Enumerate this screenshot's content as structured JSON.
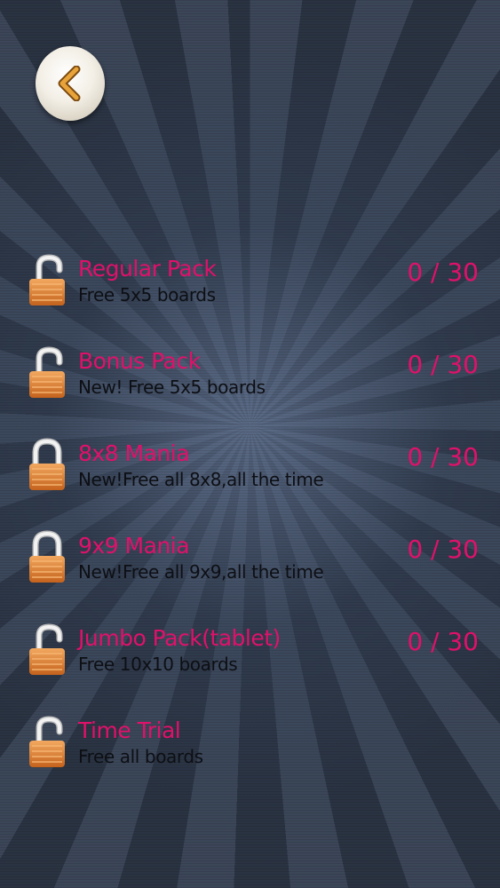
{
  "colors": {
    "accent": "#e0116a",
    "subtitle": "#0d0f14",
    "lock_body": "#e38a3c",
    "lock_shackle": "#e8e8e8"
  },
  "back_button": {
    "icon": "chevron-left-icon"
  },
  "packs": [
    {
      "title": "Regular Pack",
      "subtitle": "Free 5x5 boards",
      "progress": "0 / 30",
      "lock": "unlocked"
    },
    {
      "title": "Bonus Pack",
      "subtitle": "New! Free 5x5 boards",
      "progress": "0 / 30",
      "lock": "unlocked"
    },
    {
      "title": "8x8 Mania",
      "subtitle": "New!Free all 8x8,all the time",
      "progress": "0 / 30",
      "lock": "locked"
    },
    {
      "title": "9x9 Mania",
      "subtitle": "New!Free all 9x9,all the time",
      "progress": "0 / 30",
      "lock": "locked"
    },
    {
      "title": "Jumbo Pack(tablet)",
      "subtitle": "Free 10x10 boards",
      "progress": "0 / 30",
      "lock": "unlocked"
    },
    {
      "title": "Time Trial",
      "subtitle": "Free all boards",
      "lock": "unlocked"
    }
  ]
}
